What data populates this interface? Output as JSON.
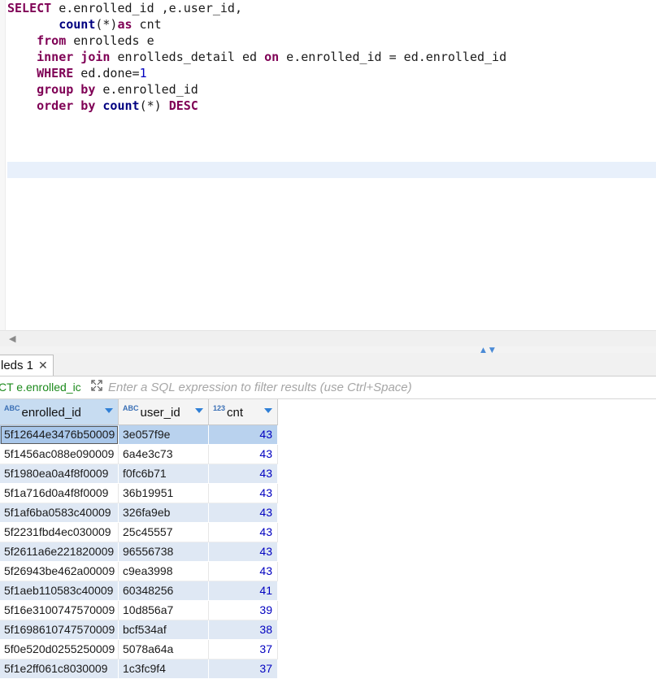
{
  "editor": {
    "lines": [
      [
        {
          "t": "SELECT",
          "c": "kw"
        },
        {
          "t": " e.enrolled_id ,e.user_id,",
          "c": ""
        }
      ],
      [
        {
          "t": "       ",
          "c": ""
        },
        {
          "t": "count",
          "c": "fn"
        },
        {
          "t": "(*)",
          "c": ""
        },
        {
          "t": "as",
          "c": "kw"
        },
        {
          "t": " cnt",
          "c": ""
        }
      ],
      [
        {
          "t": "    ",
          "c": ""
        },
        {
          "t": "from",
          "c": "kw"
        },
        {
          "t": " enrolleds e",
          "c": ""
        }
      ],
      [
        {
          "t": "    ",
          "c": ""
        },
        {
          "t": "inner join",
          "c": "kw"
        },
        {
          "t": " enrolleds_detail ed ",
          "c": ""
        },
        {
          "t": "on",
          "c": "kw"
        },
        {
          "t": " e.enrolled_id = ed.enrolled_id",
          "c": ""
        }
      ],
      [
        {
          "t": "    ",
          "c": ""
        },
        {
          "t": "WHERE",
          "c": "kw"
        },
        {
          "t": " ed.done=",
          "c": ""
        },
        {
          "t": "1",
          "c": "num"
        }
      ],
      [
        {
          "t": "    ",
          "c": ""
        },
        {
          "t": "group by",
          "c": "kw"
        },
        {
          "t": " e.enrolled_id",
          "c": ""
        }
      ],
      [
        {
          "t": "    ",
          "c": ""
        },
        {
          "t": "order by",
          "c": "kw"
        },
        {
          "t": " ",
          "c": ""
        },
        {
          "t": "count",
          "c": "fn"
        },
        {
          "t": "(*) ",
          "c": ""
        },
        {
          "t": "DESC",
          "c": "kw"
        }
      ]
    ]
  },
  "results": {
    "tab_label": "leds 1",
    "tab_close": "✕",
    "filter_prefix": "CT e.enrolled_ic",
    "filter_placeholder": "Enter a SQL expression to filter results (use Ctrl+Space)",
    "columns": [
      {
        "label": "enrolled_id",
        "type": "ABC"
      },
      {
        "label": "user_id",
        "type": "ABC"
      },
      {
        "label": "cnt",
        "type": "123"
      }
    ],
    "rows": [
      [
        "5f12644e3476b50009",
        "3e057f9e",
        "43"
      ],
      [
        "5f1456ac088e090009",
        "6a4e3c73",
        "43"
      ],
      [
        "5f1980ea0a4f8f0009",
        "f0fc6b71",
        "43"
      ],
      [
        "5f1a716d0a4f8f0009",
        "36b19951",
        "43"
      ],
      [
        "5f1af6ba0583c40009",
        "326fa9eb",
        "43"
      ],
      [
        "5f2231fbd4ec030009",
        "25c45557",
        "43"
      ],
      [
        "5f2611a6e221820009",
        "96556738",
        "43"
      ],
      [
        "5f26943be462a00009",
        "c9ea3998",
        "43"
      ],
      [
        "5f1aeb110583c40009",
        "60348256",
        "41"
      ],
      [
        "5f16e3100747570009",
        "10d856a7",
        "39"
      ],
      [
        "5f1698610747570009",
        "bcf534af",
        "38"
      ],
      [
        "5f0e520d0255250009",
        "5078a64a",
        "37"
      ],
      [
        "5f1e2ff061c8030009",
        "1c3fc9f4",
        "37"
      ]
    ]
  },
  "icons": {
    "scroll_left": "◀",
    "splitter_handle": "▲▼"
  }
}
